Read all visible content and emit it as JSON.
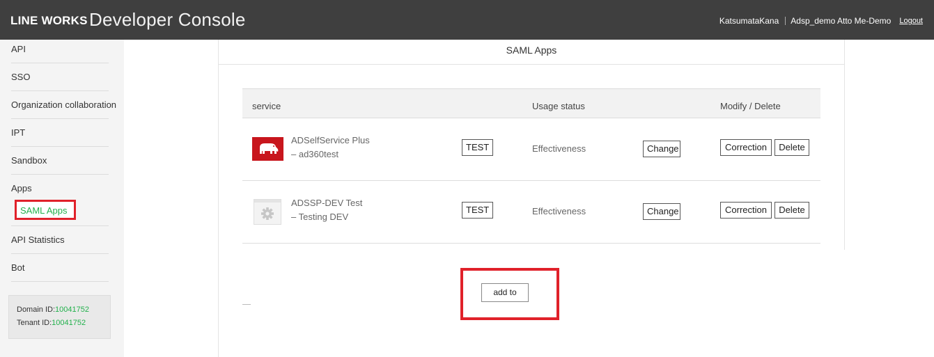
{
  "header": {
    "brand": "LINE WORKS",
    "title": "Developer Console",
    "user_name": "KatsumataKana",
    "tenant": "Adsp_demo Atto Me-Demo",
    "logout": "Logout"
  },
  "sidebar": {
    "items": [
      {
        "label": "API"
      },
      {
        "label": "SSO"
      },
      {
        "label": "Organization collaboration"
      },
      {
        "label": "IPT"
      },
      {
        "label": "Sandbox"
      },
      {
        "label": "Apps"
      },
      {
        "label": "SAML Apps"
      },
      {
        "label": "API Statistics"
      },
      {
        "label": "Bot"
      }
    ],
    "domain_label": "Domain ID:",
    "domain_id": "10041752",
    "tenant_label": "Tenant ID:",
    "tenant_id": "10041752"
  },
  "main": {
    "title": "SAML Apps",
    "columns": {
      "service": "service",
      "usage": "Usage status",
      "modify": "Modify / Delete"
    },
    "rows": [
      {
        "name_line1": "ADSelfService Plus",
        "name_line2": "– ad360test",
        "icon": "elephant-icon",
        "test_label": "TEST",
        "status": "Effectiveness",
        "change_label": "Change",
        "correction_label": "Correction",
        "delete_label": "Delete"
      },
      {
        "name_line1": "ADSSP-DEV Test",
        "name_line2": "– Testing DEV",
        "icon": "gear-icon",
        "test_label": "TEST",
        "status": "Effectiveness",
        "change_label": "Change",
        "correction_label": "Correction",
        "delete_label": "Delete"
      }
    ],
    "add_label": "add to"
  },
  "colors": {
    "header_bg": "#3f3f3f",
    "highlight_red": "#e0212a",
    "link_green": "#22b14c",
    "app_icon_red": "#c8161d"
  }
}
